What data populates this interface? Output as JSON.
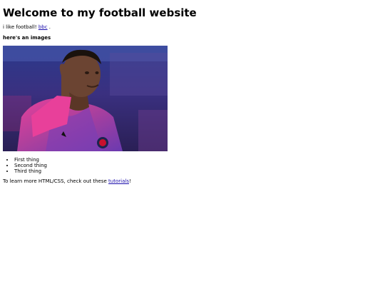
{
  "heading": "Welcome to my football website",
  "intro": {
    "text": "i like football! ",
    "link_label": "bbc",
    "suffix": " ."
  },
  "subheading": "here's an images",
  "image": {
    "colors": {
      "sky_top": "#2b3a8c",
      "sky_bottom": "#3d2a6a",
      "jersey_pink": "#e0388e",
      "jersey_purple": "#7a3fb6",
      "skin": "#6b4432"
    }
  },
  "list_items": [
    "First thing",
    "Second thing",
    "Third thing"
  ],
  "outro": {
    "text": "To learn more HTML/CSS, check out these ",
    "link_label": "tutorials",
    "suffix": "!"
  }
}
